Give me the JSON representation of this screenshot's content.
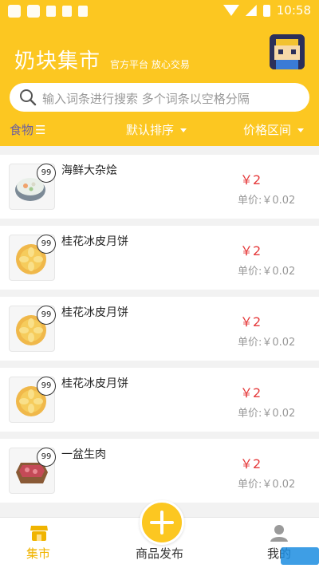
{
  "status_bar": {
    "time": "10:58"
  },
  "header": {
    "title": "奶块集市",
    "subtitle": "官方平台 放心交易",
    "search_placeholder": "输入词条进行搜索 多个词条以空格分隔"
  },
  "filters": {
    "category_label": "食物",
    "sort_label": "默认排序",
    "price_label": "价格区间"
  },
  "items": [
    {
      "name": "海鲜大杂烩",
      "quantity": "99",
      "price": "￥2",
      "unit_price": "单价:￥0.02",
      "icon": "seafood-stew-icon"
    },
    {
      "name": "桂花冰皮月饼",
      "quantity": "99",
      "price": "￥2",
      "unit_price": "单价:￥0.02",
      "icon": "mooncake-icon"
    },
    {
      "name": "桂花冰皮月饼",
      "quantity": "99",
      "price": "￥2",
      "unit_price": "单价:￥0.02",
      "icon": "mooncake-icon"
    },
    {
      "name": "桂花冰皮月饼",
      "quantity": "99",
      "price": "￥2",
      "unit_price": "单价:￥0.02",
      "icon": "mooncake-icon"
    },
    {
      "name": "一盆生肉",
      "quantity": "99",
      "price": "￥2",
      "unit_price": "单价:￥0.02",
      "icon": "raw-meat-icon"
    }
  ],
  "tabbar": {
    "market_label": "集市",
    "publish_label": "商品发布",
    "mine_label": "我的"
  },
  "colors": {
    "brand": "#fcc721",
    "price": "#e5393a",
    "active_tab": "#f0b400"
  }
}
